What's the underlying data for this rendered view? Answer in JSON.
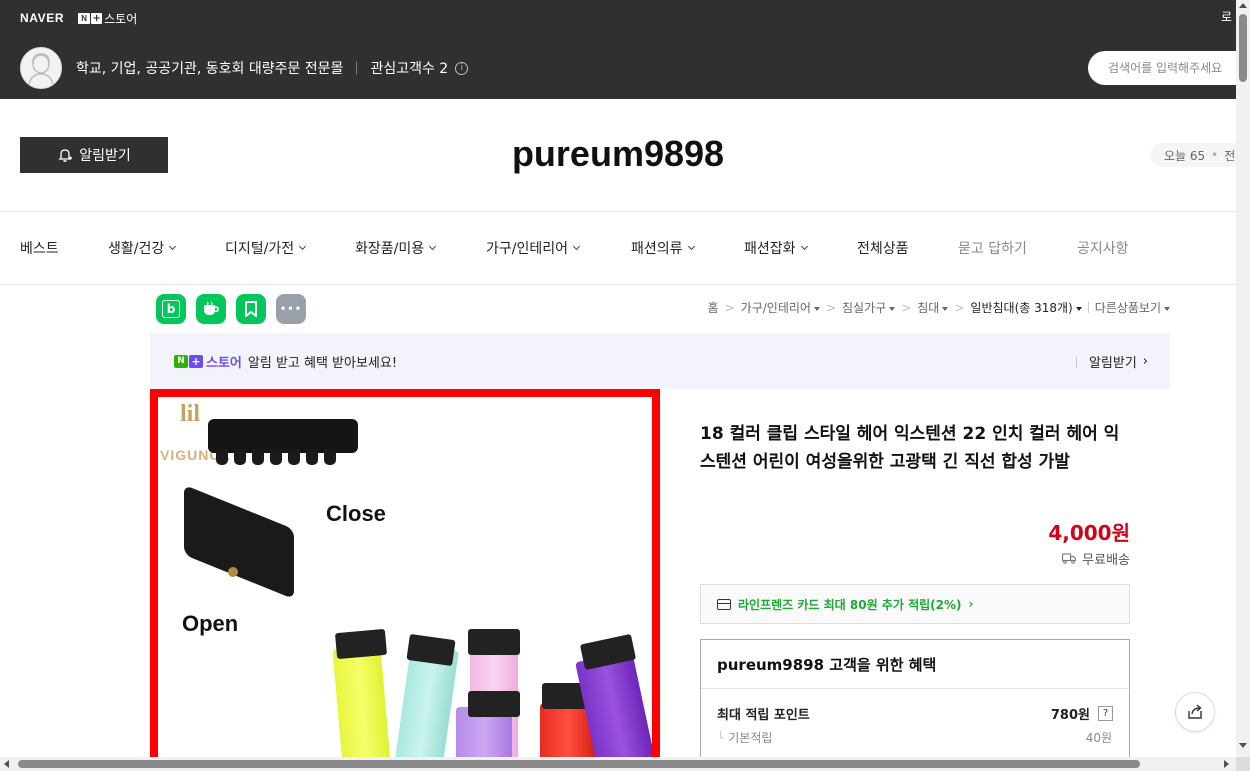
{
  "top": {
    "naver_logo": "NAVER",
    "store_brand": "스토어",
    "login_stub": "로",
    "store_desc": "학교, 기업, 공공기관, 동호회 대량주문 전문몰",
    "followers": "관심고객수 2",
    "search_placeholder": "검색어를 입력해주세요"
  },
  "header": {
    "alarm_label": "알림받기",
    "store_name": "pureum9898",
    "visits_today": "오늘 65",
    "visits_total_stub": "전체"
  },
  "nav": [
    {
      "label": "베스트",
      "dropdown": false,
      "muted": false
    },
    {
      "label": "생활/건강",
      "dropdown": true,
      "muted": false
    },
    {
      "label": "디지털/가전",
      "dropdown": true,
      "muted": false
    },
    {
      "label": "화장품/미용",
      "dropdown": true,
      "muted": false
    },
    {
      "label": "가구/인테리어",
      "dropdown": true,
      "muted": false
    },
    {
      "label": "패션의류",
      "dropdown": true,
      "muted": false
    },
    {
      "label": "패션잡화",
      "dropdown": true,
      "muted": false
    },
    {
      "label": "전체상품",
      "dropdown": false,
      "muted": false
    },
    {
      "label": "묻고 답하기",
      "dropdown": false,
      "muted": true
    },
    {
      "label": "공지사항",
      "dropdown": false,
      "muted": true
    }
  ],
  "sns": [
    {
      "name": "blog-share-icon",
      "glyph": "b",
      "color": "#03c75a"
    },
    {
      "name": "talk-share-icon",
      "glyph": "✿",
      "color": "#03c75a"
    },
    {
      "name": "kakao-share-icon",
      "glyph": "K",
      "color": "#03c75a"
    },
    {
      "name": "more-share-icon",
      "glyph": "•••",
      "color": "#9aa0aa"
    }
  ],
  "breadcrumb": {
    "home": "홈",
    "c1": "가구/인테리어",
    "c2": "침실가구",
    "c3": "침대",
    "current": "일반침대",
    "count": "(총 318개)",
    "other": "다른상품보기"
  },
  "banner": {
    "store": "스토어",
    "text": "알림 받고 혜택 받아보세요!",
    "right": "알림받기"
  },
  "image_text": {
    "brand": "VIGUNOL",
    "close": "Close",
    "open": "Open"
  },
  "product": {
    "title": "18 컬러 클립 스타일 헤어 익스텐션 22 인치 컬러 헤어 익스텐션 어린이 여성을위한 고광택 긴 직선 합성 가발",
    "price": "4,000원",
    "shipping": "무료배송",
    "card_promo": "라인프렌즈 카드 최대 80원 추가 적립(2%)",
    "benefit_title": "pureum9898 고객을 위한 혜택",
    "benefit_rows": [
      {
        "label": "최대 적립 포인트",
        "value": "780원"
      },
      {
        "label": "기본적립",
        "value": "40원"
      }
    ]
  },
  "colors": {
    "topbar": "#303030",
    "price_red": "#d0021b",
    "naver_green": "#03c75a",
    "plus_purple": "#6b4cf0",
    "card_green": "#1ea838",
    "image_border": "#ff0000"
  }
}
